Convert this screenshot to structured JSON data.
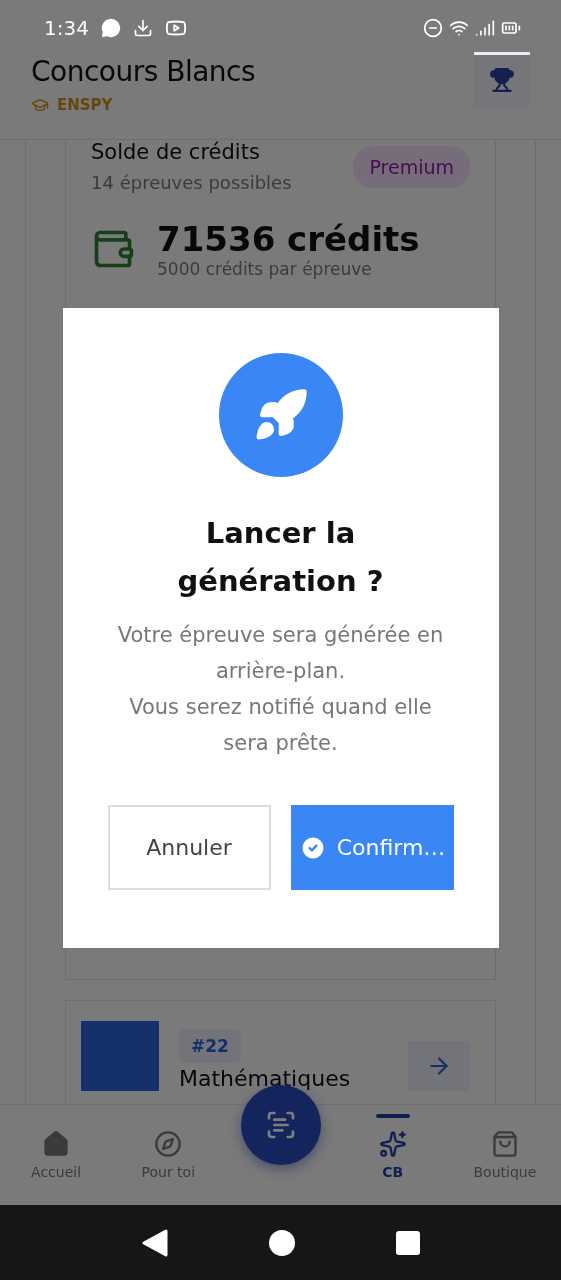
{
  "status_bar": {
    "time": "1:34"
  },
  "header": {
    "title": "Concours Blancs",
    "school": "ENSPY"
  },
  "credits_card": {
    "title": "Solde de crédits",
    "subtitle": "14 épreuves possibles",
    "badge": "Premium",
    "amount": "71536 crédits",
    "note": "5000 crédits par épreuve"
  },
  "exam_card": {
    "number": "#22",
    "subject": "Mathématiques"
  },
  "dialog": {
    "title": "Lancer la génération ?",
    "message": [
      "Votre épreuve sera générée en arrière-plan.",
      "Vous serez notifié quand elle sera prête."
    ],
    "buttons": [
      {
        "label": "Annuler",
        "kind": "secondary"
      },
      {
        "label": "Confirm…",
        "kind": "primary"
      }
    ]
  },
  "bottom_nav": [
    {
      "label": "Accueil",
      "kind": "home",
      "selected": false
    },
    {
      "label": "Pour toi",
      "kind": "compass",
      "selected": false
    },
    {
      "kind": "fab"
    },
    {
      "label": "CB",
      "kind": "chart",
      "selected": true
    },
    {
      "label": "Boutique",
      "kind": "shop",
      "selected": false
    }
  ]
}
